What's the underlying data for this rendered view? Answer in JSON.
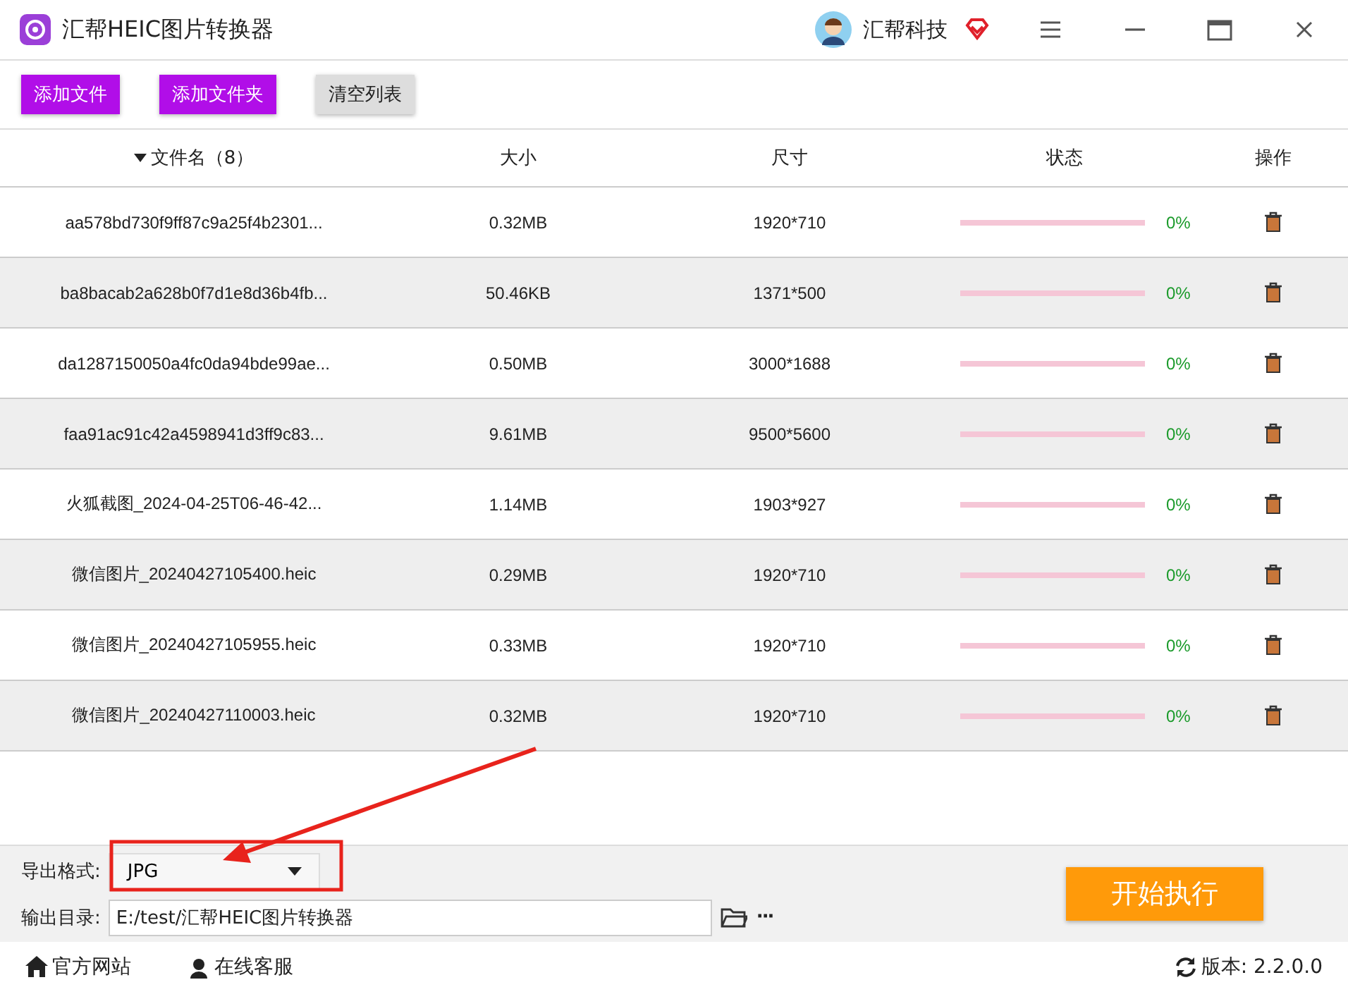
{
  "window": {
    "title": "汇帮HEIC图片转换器",
    "user": "汇帮科技"
  },
  "toolbar": [
    {
      "label": "添加文件",
      "kind": "primary"
    },
    {
      "label": "添加文件夹",
      "kind": "primary"
    },
    {
      "label": "清空列表",
      "kind": "secondary"
    }
  ],
  "table": {
    "columns": [
      "文件名（8）",
      "大小",
      "尺寸",
      "状态",
      "操作"
    ],
    "rows": [
      {
        "name": "aa578bd730f9ff87c9a25f4b2301...",
        "size": "0.32MB",
        "dimensions": "1920*710",
        "level": 0,
        "percent": "0%"
      },
      {
        "name": "ba8bacab2a628b0f7d1e8d36b4fb...",
        "size": "50.46KB",
        "dimensions": "1371*500",
        "level": 0,
        "percent": "0%"
      },
      {
        "name": "da1287150050a4fc0da94bde99ae...",
        "size": "0.50MB",
        "dimensions": "3000*1688",
        "level": 0,
        "percent": "0%"
      },
      {
        "name": "faa91ac91c42a4598941d3ff9c83...",
        "size": "9.61MB",
        "dimensions": "9500*5600",
        "level": 0,
        "percent": "0%"
      },
      {
        "name": "火狐截图_2024-04-25T06-46-42...",
        "size": "1.14MB",
        "dimensions": "1903*927",
        "level": 0,
        "percent": "0%"
      },
      {
        "name": "微信图片_20240427105400.heic",
        "size": "0.29MB",
        "dimensions": "1920*710",
        "level": 0,
        "percent": "0%"
      },
      {
        "name": "微信图片_20240427105955.heic",
        "size": "0.33MB",
        "dimensions": "1920*710",
        "level": 0,
        "percent": "0%"
      },
      {
        "name": "微信图片_20240427110003.heic",
        "size": "0.32MB",
        "dimensions": "1920*710",
        "level": 0,
        "percent": "0%"
      }
    ]
  },
  "settings": {
    "format_label": "导出格式:",
    "format": "JPG",
    "output_label": "输出目录:",
    "output_path": "E:/test/汇帮HEIC图片转换器",
    "more": "···",
    "start": "开始执行"
  },
  "footer": {
    "website": "官方网站",
    "support": "在线客服",
    "version": "版本:  2.2.0.0"
  }
}
